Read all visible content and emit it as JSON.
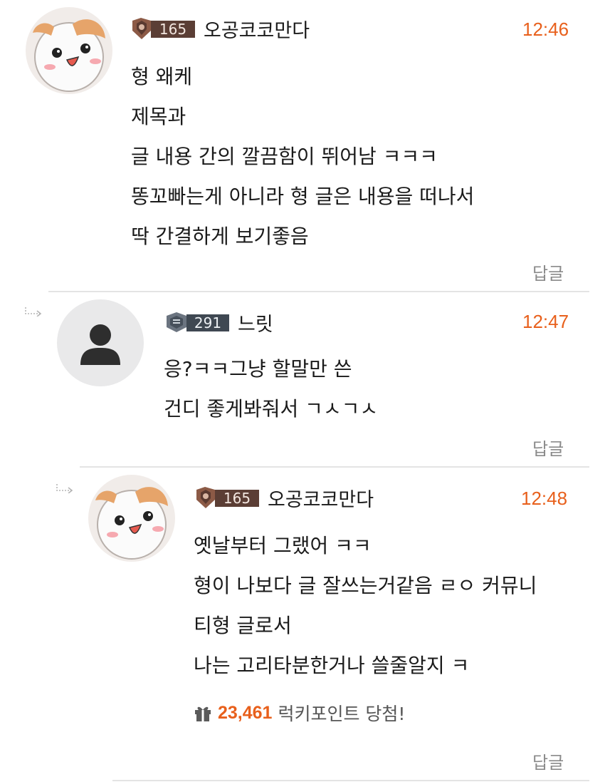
{
  "comments": [
    {
      "level": "165",
      "nickname": "오공코코만다",
      "time": "12:46",
      "lines": [
        "형 왜케",
        "제목과",
        "글 내용 간의 깔끔함이 뛰어남 ㅋㅋㅋ",
        "똥꼬빠는게 아니라 형 글은 내용을 떠나서",
        "딱 간결하게 보기좋음"
      ],
      "reply_label": "답글"
    },
    {
      "level": "291",
      "nickname": "느릿",
      "time": "12:47",
      "lines": [
        "응?ㅋㅋ그냥 할말만 쓴",
        "건디 좋게봐줘서 ㄱㅅㄱㅅ"
      ],
      "reply_label": "답글"
    },
    {
      "level": "165",
      "nickname": "오공코코만다",
      "time": "12:48",
      "lines": [
        "옛날부터 그랬어 ㅋㅋ",
        "형이 나보다 글 잘쓰는거같음 ㄹㅇ 커뮤니",
        "티형 글로서",
        "나는 고리타분한거나 쓸줄알지 ㅋ"
      ],
      "lucky": {
        "icon": "gift-icon",
        "amount": "23,461",
        "text": "럭키포인트 당첨!"
      },
      "reply_label": "답글"
    }
  ],
  "colors": {
    "accent": "#e8601c",
    "divider": "#e4e4e4",
    "muted": "#8a8a8a"
  }
}
